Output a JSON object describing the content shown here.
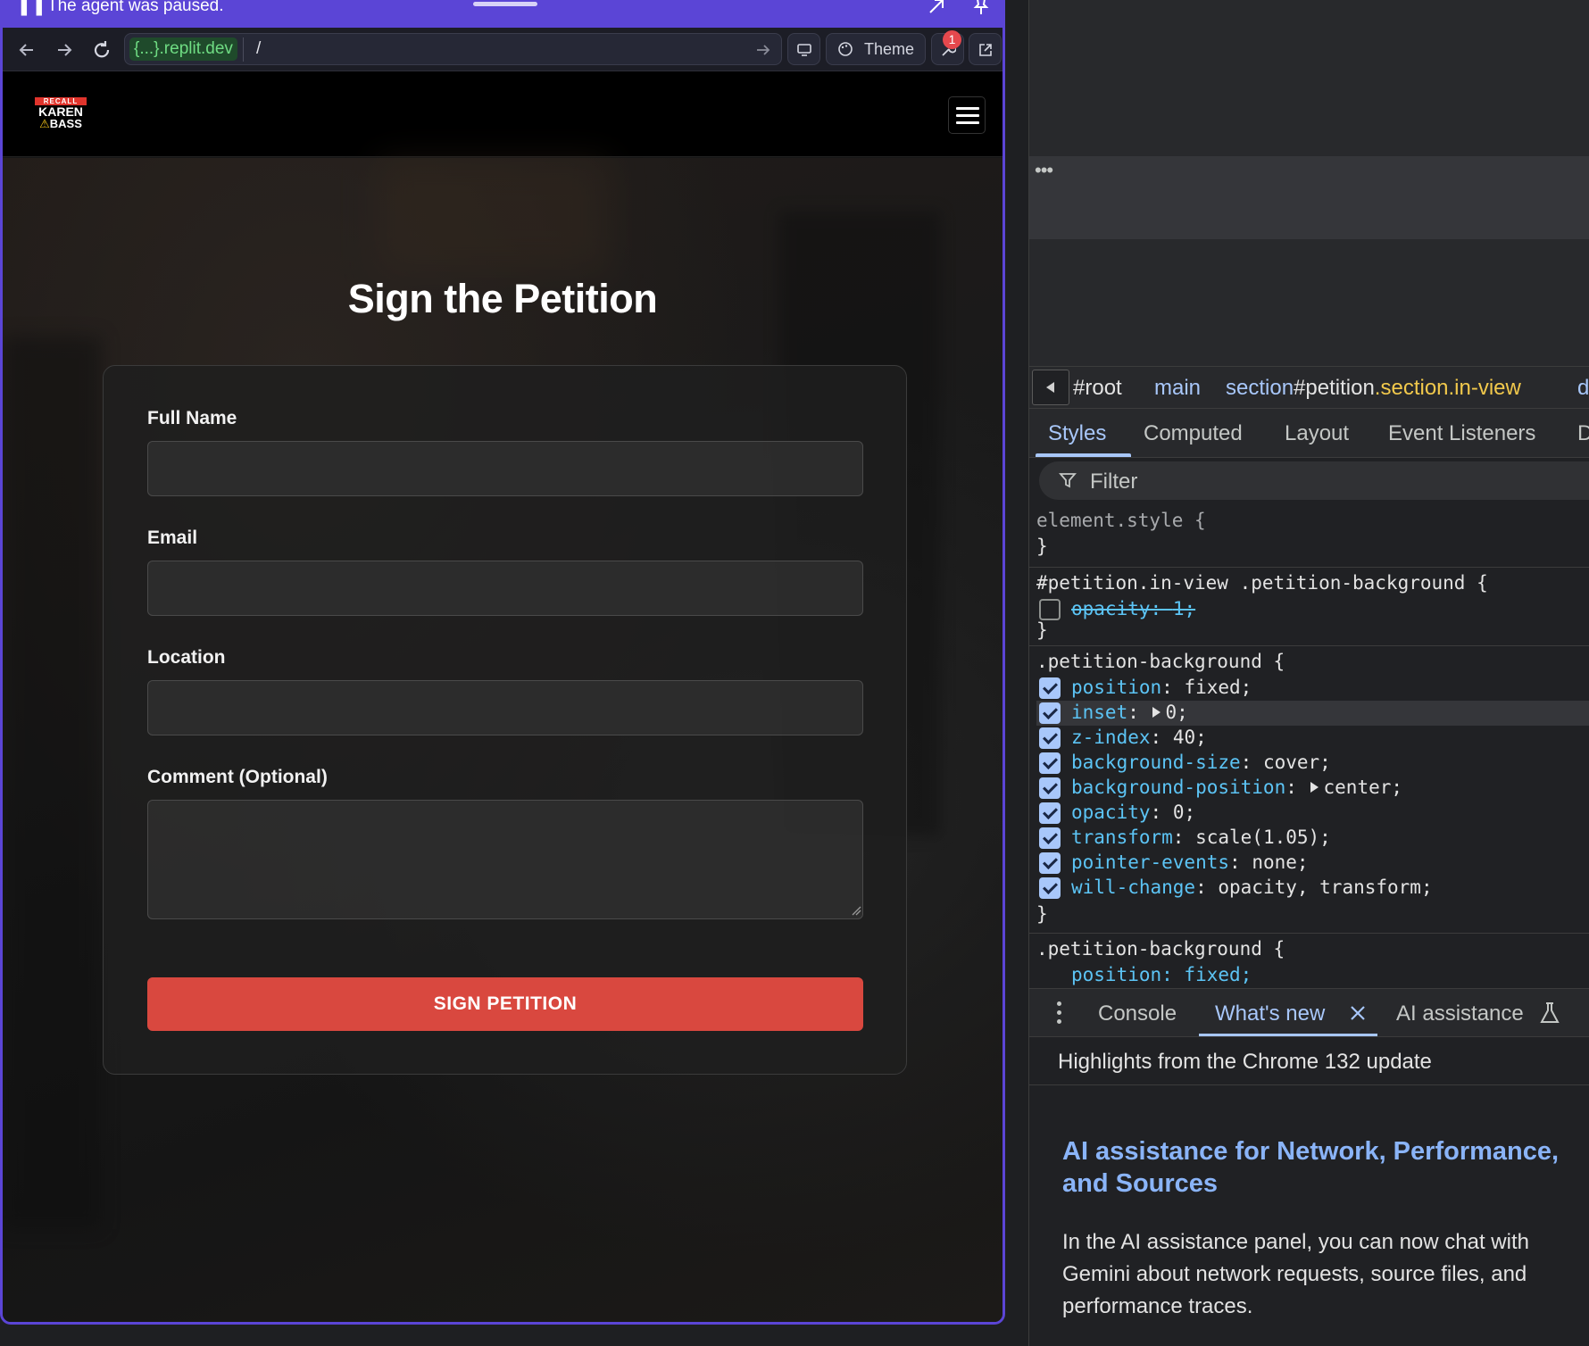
{
  "agent_bar": {
    "message": "The agent was paused."
  },
  "url_bar": {
    "host_prefix": "{...}",
    "host_domain": ".replit.dev",
    "path": "/",
    "theme_label": "Theme",
    "notification_count": "1"
  },
  "site": {
    "logo": {
      "line1": "RECALL",
      "line2": "KAREN",
      "line3_symbol": "⚠",
      "line3": "BASS"
    },
    "page_title": "Sign the Petition",
    "form": {
      "fields": [
        {
          "label": "Full Name",
          "value": ""
        },
        {
          "label": "Email",
          "value": ""
        },
        {
          "label": "Location",
          "value": ""
        },
        {
          "label": "Comment (Optional)",
          "value": ""
        }
      ],
      "submit_label": "SIGN PETITION"
    }
  },
  "devtools": {
    "breadcrumbs": [
      {
        "text": "#root"
      },
      {
        "text": "main"
      },
      {
        "tag": "section",
        "id": "#petition",
        "classes": ".section.in-view"
      },
      {
        "text": "d"
      }
    ],
    "tabs": [
      "Styles",
      "Computed",
      "Layout",
      "Event Listeners",
      "D"
    ],
    "filter_placeholder": "Filter",
    "rules": [
      {
        "selector": "element.style {",
        "close": "}"
      },
      {
        "selector": "#petition.in-view .petition-background {",
        "close": "}"
      },
      {
        "selector": ".petition-background {",
        "close": "}"
      },
      {
        "selector": ".petition-background {"
      }
    ],
    "rule2_props": [
      {
        "name": "opacity",
        "value": "1",
        "enabled": false
      }
    ],
    "rule3_props": [
      {
        "name": "position",
        "value": "fixed"
      },
      {
        "name": "inset",
        "value": "0",
        "expandable": true
      },
      {
        "name": "z-index",
        "value": "40"
      },
      {
        "name": "background-size",
        "value": "cover"
      },
      {
        "name": "background-position",
        "value": "center",
        "expandable": true
      },
      {
        "name": "opacity",
        "value": "0"
      },
      {
        "name": "transform",
        "value": "scale(1.05)"
      },
      {
        "name": "pointer-events",
        "value": "none"
      },
      {
        "name": "will-change",
        "value": "opacity, transform"
      }
    ],
    "rule4_partial": "position: fixed;",
    "drawer": {
      "tabs": [
        "Console",
        "What's new",
        "AI assistance"
      ],
      "active": "What's new",
      "header": "Highlights from the Chrome 132 update",
      "title": "AI assistance for Network, Performance, and Sources",
      "body": "In the AI assistance panel, you can now chat with Gemini about network requests, source files, and performance traces."
    }
  }
}
